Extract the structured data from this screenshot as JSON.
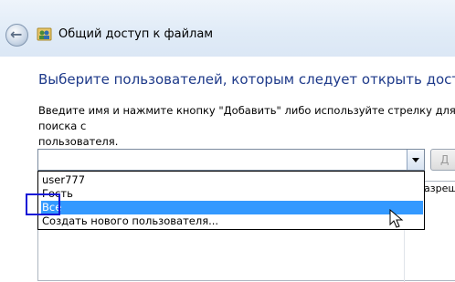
{
  "window": {
    "title": "Общий доступ к файлам",
    "back_icon": "back-arrow-icon",
    "app_icon": "users-icon"
  },
  "main": {
    "heading": "Выберите пользователей, которым следует открыть доступ",
    "instruction": "Введите имя и нажмите кнопку \"Добавить\" либо используйте стрелку для поиска с\nпользователя."
  },
  "combo": {
    "value": "",
    "add_button_label": "Д"
  },
  "dropdown": {
    "items": [
      "user777",
      "Гость",
      "Все",
      "Создать нового пользователя..."
    ],
    "selected_index": 2
  },
  "table": {
    "permission_header": "азреш"
  },
  "colors": {
    "heading": "#1e3a8a",
    "selection": "#3399ff",
    "focus_box": "#1515d6"
  }
}
